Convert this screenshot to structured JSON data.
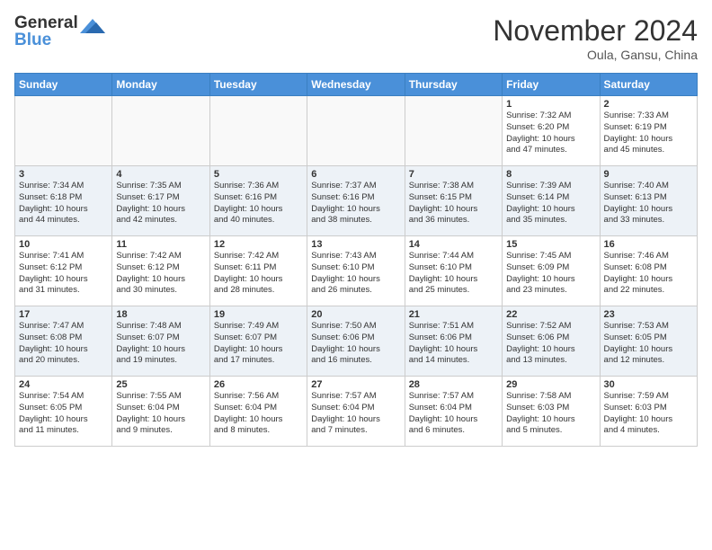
{
  "header": {
    "logo_line1": "General",
    "logo_line2": "Blue",
    "month": "November 2024",
    "location": "Oula, Gansu, China"
  },
  "weekdays": [
    "Sunday",
    "Monday",
    "Tuesday",
    "Wednesday",
    "Thursday",
    "Friday",
    "Saturday"
  ],
  "weeks": [
    [
      {
        "day": "",
        "info": ""
      },
      {
        "day": "",
        "info": ""
      },
      {
        "day": "",
        "info": ""
      },
      {
        "day": "",
        "info": ""
      },
      {
        "day": "",
        "info": ""
      },
      {
        "day": "1",
        "info": "Sunrise: 7:32 AM\nSunset: 6:20 PM\nDaylight: 10 hours\nand 47 minutes."
      },
      {
        "day": "2",
        "info": "Sunrise: 7:33 AM\nSunset: 6:19 PM\nDaylight: 10 hours\nand 45 minutes."
      }
    ],
    [
      {
        "day": "3",
        "info": "Sunrise: 7:34 AM\nSunset: 6:18 PM\nDaylight: 10 hours\nand 44 minutes."
      },
      {
        "day": "4",
        "info": "Sunrise: 7:35 AM\nSunset: 6:17 PM\nDaylight: 10 hours\nand 42 minutes."
      },
      {
        "day": "5",
        "info": "Sunrise: 7:36 AM\nSunset: 6:16 PM\nDaylight: 10 hours\nand 40 minutes."
      },
      {
        "day": "6",
        "info": "Sunrise: 7:37 AM\nSunset: 6:16 PM\nDaylight: 10 hours\nand 38 minutes."
      },
      {
        "day": "7",
        "info": "Sunrise: 7:38 AM\nSunset: 6:15 PM\nDaylight: 10 hours\nand 36 minutes."
      },
      {
        "day": "8",
        "info": "Sunrise: 7:39 AM\nSunset: 6:14 PM\nDaylight: 10 hours\nand 35 minutes."
      },
      {
        "day": "9",
        "info": "Sunrise: 7:40 AM\nSunset: 6:13 PM\nDaylight: 10 hours\nand 33 minutes."
      }
    ],
    [
      {
        "day": "10",
        "info": "Sunrise: 7:41 AM\nSunset: 6:12 PM\nDaylight: 10 hours\nand 31 minutes."
      },
      {
        "day": "11",
        "info": "Sunrise: 7:42 AM\nSunset: 6:12 PM\nDaylight: 10 hours\nand 30 minutes."
      },
      {
        "day": "12",
        "info": "Sunrise: 7:42 AM\nSunset: 6:11 PM\nDaylight: 10 hours\nand 28 minutes."
      },
      {
        "day": "13",
        "info": "Sunrise: 7:43 AM\nSunset: 6:10 PM\nDaylight: 10 hours\nand 26 minutes."
      },
      {
        "day": "14",
        "info": "Sunrise: 7:44 AM\nSunset: 6:10 PM\nDaylight: 10 hours\nand 25 minutes."
      },
      {
        "day": "15",
        "info": "Sunrise: 7:45 AM\nSunset: 6:09 PM\nDaylight: 10 hours\nand 23 minutes."
      },
      {
        "day": "16",
        "info": "Sunrise: 7:46 AM\nSunset: 6:08 PM\nDaylight: 10 hours\nand 22 minutes."
      }
    ],
    [
      {
        "day": "17",
        "info": "Sunrise: 7:47 AM\nSunset: 6:08 PM\nDaylight: 10 hours\nand 20 minutes."
      },
      {
        "day": "18",
        "info": "Sunrise: 7:48 AM\nSunset: 6:07 PM\nDaylight: 10 hours\nand 19 minutes."
      },
      {
        "day": "19",
        "info": "Sunrise: 7:49 AM\nSunset: 6:07 PM\nDaylight: 10 hours\nand 17 minutes."
      },
      {
        "day": "20",
        "info": "Sunrise: 7:50 AM\nSunset: 6:06 PM\nDaylight: 10 hours\nand 16 minutes."
      },
      {
        "day": "21",
        "info": "Sunrise: 7:51 AM\nSunset: 6:06 PM\nDaylight: 10 hours\nand 14 minutes."
      },
      {
        "day": "22",
        "info": "Sunrise: 7:52 AM\nSunset: 6:06 PM\nDaylight: 10 hours\nand 13 minutes."
      },
      {
        "day": "23",
        "info": "Sunrise: 7:53 AM\nSunset: 6:05 PM\nDaylight: 10 hours\nand 12 minutes."
      }
    ],
    [
      {
        "day": "24",
        "info": "Sunrise: 7:54 AM\nSunset: 6:05 PM\nDaylight: 10 hours\nand 11 minutes."
      },
      {
        "day": "25",
        "info": "Sunrise: 7:55 AM\nSunset: 6:04 PM\nDaylight: 10 hours\nand 9 minutes."
      },
      {
        "day": "26",
        "info": "Sunrise: 7:56 AM\nSunset: 6:04 PM\nDaylight: 10 hours\nand 8 minutes."
      },
      {
        "day": "27",
        "info": "Sunrise: 7:57 AM\nSunset: 6:04 PM\nDaylight: 10 hours\nand 7 minutes."
      },
      {
        "day": "28",
        "info": "Sunrise: 7:57 AM\nSunset: 6:04 PM\nDaylight: 10 hours\nand 6 minutes."
      },
      {
        "day": "29",
        "info": "Sunrise: 7:58 AM\nSunset: 6:03 PM\nDaylight: 10 hours\nand 5 minutes."
      },
      {
        "day": "30",
        "info": "Sunrise: 7:59 AM\nSunset: 6:03 PM\nDaylight: 10 hours\nand 4 minutes."
      }
    ]
  ]
}
